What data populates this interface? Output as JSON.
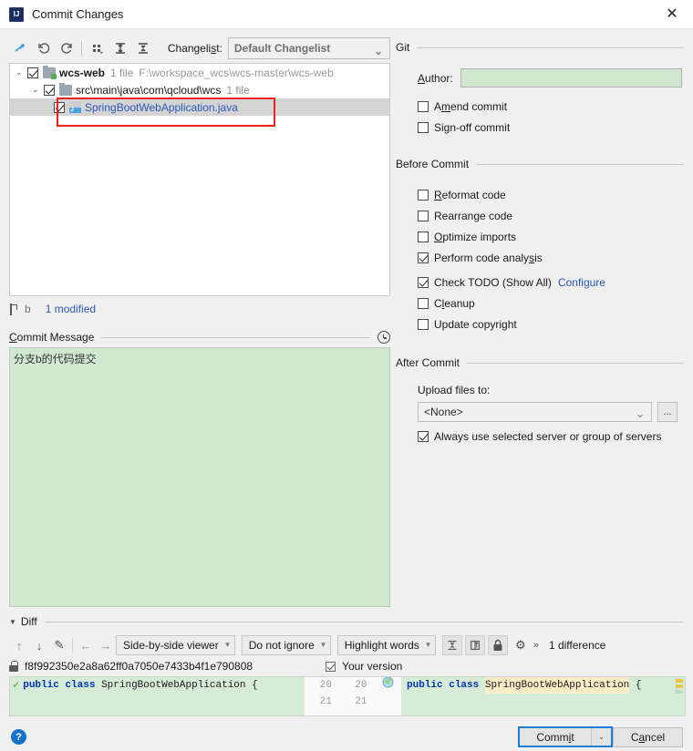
{
  "window": {
    "title": "Commit Changes",
    "app_icon": "intellij-idea-icon",
    "close_label": "✕"
  },
  "toolbar": {
    "icons": [
      "move-to-changelist-icon",
      "revert-icon",
      "refresh-icon",
      "group-by-icon",
      "expand-all-icon",
      "collapse-all-icon"
    ],
    "changelist_label": "Changelist:",
    "changelist_value": "Default Changelist",
    "chevron": "⌄"
  },
  "file_tree": {
    "nodes": [
      {
        "name": "wcs-web",
        "meta": "1 file",
        "path": "F:\\workspace_wcs\\wcs-master\\wcs-web",
        "twisty": "⌄",
        "icon": "module-folder-icon"
      },
      {
        "name": "src\\main\\java\\com\\qcloud\\wcs",
        "meta": "1 file",
        "path": "",
        "twisty": "⌄",
        "icon": "folder-icon"
      },
      {
        "name": "SpringBootWebApplication.java",
        "meta": "",
        "path": "",
        "twisty": "",
        "icon": "java-file-icon"
      }
    ]
  },
  "status": {
    "branch_icon": "branch-icon",
    "branch": "b",
    "modified": "1 modified"
  },
  "commit_message": {
    "label": "Commit Message",
    "history_icon": "clock-history-icon",
    "value": "分支b的代码提交"
  },
  "git_section": {
    "title": "Git",
    "author_label": "Author:",
    "author_value": "",
    "checkboxes": [
      {
        "label": "Amend commit",
        "checked": false
      },
      {
        "label": "Sign-off commit",
        "checked": false
      }
    ]
  },
  "before_commit": {
    "title": "Before Commit",
    "checkboxes": [
      {
        "label": "Reformat code",
        "checked": false
      },
      {
        "label": "Rearrange code",
        "checked": false
      },
      {
        "label": "Optimize imports",
        "checked": false
      },
      {
        "label": "Perform code analysis",
        "checked": true
      },
      {
        "label": "Check TODO (Show All)",
        "checked": true,
        "link": "Configure"
      },
      {
        "label": "Cleanup",
        "checked": false
      },
      {
        "label": "Update copyright",
        "checked": false
      }
    ]
  },
  "after_commit": {
    "title": "After Commit",
    "upload_label": "Upload files to:",
    "upload_value": "<None>",
    "browse_label": "...",
    "chevron": "⌄",
    "always_use": {
      "label": "Always use selected server or group of servers",
      "checked": true
    }
  },
  "diff": {
    "title": "Diff",
    "twisty": "▼",
    "viewer_mode": "Side-by-side viewer",
    "ignore_mode": "Do not ignore",
    "highlight_mode": "Highlight words",
    "difference_count": "1 difference",
    "chevrons": "»",
    "toolbar_icons": [
      "prev-diff-icon",
      "next-diff-icon",
      "edit-icon",
      "apply-left-icon",
      "apply-right-icon",
      "collapse-unchanged-icon",
      "whitespace-icon",
      "lock-icon",
      "settings-icon"
    ],
    "left_revision": "f8f992350e2a8a62ff0a7050e7433b4f1e790808",
    "right_label": "Your version",
    "left_lines": [
      {
        "text": "public class SpringBootWebApplication {",
        "kind": "inserted"
      },
      {
        "text": "",
        "kind": "inserted"
      }
    ],
    "right_lines": [
      {
        "text": "public class SpringBootWebApplication {",
        "kind": "inserted"
      },
      {
        "text": "",
        "kind": "inserted"
      }
    ],
    "gutter": [
      {
        "left": "20",
        "right": "20"
      },
      {
        "left": "21",
        "right": "21"
      }
    ],
    "keyword1": "public",
    "keyword2": "class",
    "classname": "SpringBootWebApplication",
    "brace": "{"
  },
  "footer": {
    "help_label": "?",
    "commit_label": "Commit",
    "commit_chevron": "⌄",
    "cancel_label": "Cancel"
  }
}
